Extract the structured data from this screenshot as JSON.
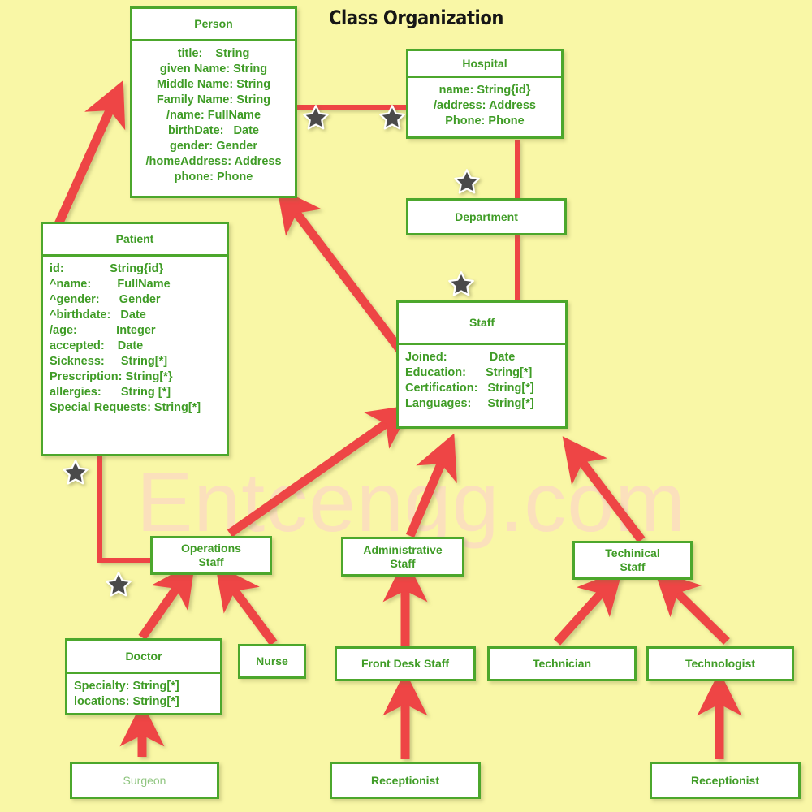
{
  "title": "Class Organization",
  "watermark": "Entcengg.com",
  "colors": {
    "background": "#f9f7a6",
    "class_border": "#4ca72c",
    "class_text": "#3f9c26",
    "connector": "#ee4444",
    "title_text": "#161616",
    "watermark": "#fbe0bc",
    "star": "#4a4a4a"
  },
  "classes": [
    {
      "id": "person",
      "name": "Person",
      "attributes": [
        "title:    String",
        "given Name: String",
        "Middle Name: String",
        "Family Name: String",
        "/name: FullName",
        "birthDate:   Date",
        "gender: Gender",
        "/homeAddress: Address",
        "phone: Phone"
      ]
    },
    {
      "id": "hospital",
      "name": "Hospital",
      "attributes": [
        "name: String{id}",
        "/address: Address",
        "Phone: Phone"
      ]
    },
    {
      "id": "patient",
      "name": "Patient",
      "attributes": [
        "id:              String{id}",
        "^name:        FullName",
        "^gender:      Gender",
        "^birthdate:   Date",
        "/age:            Integer",
        "accepted:    Date",
        "Sickness:     String[*]",
        "Prescription: String[*}",
        "allergies:      String [*]",
        "Special Requests: String[*]"
      ]
    },
    {
      "id": "department",
      "name": "Department",
      "attributes": []
    },
    {
      "id": "staff",
      "name": "Staff",
      "attributes": [
        "Joined:             Date",
        "Education:      String[*]",
        "Certification:   String[*]",
        "Languages:     String[*]"
      ]
    },
    {
      "id": "operations-staff",
      "name": "Operations\nStaff",
      "attributes": []
    },
    {
      "id": "administrative-staff",
      "name": "Administrative\nStaff",
      "attributes": []
    },
    {
      "id": "technical-staff",
      "name": "Techinical\nStaff",
      "attributes": []
    },
    {
      "id": "doctor",
      "name": "Doctor",
      "attributes": [
        "Specialty: String[*]",
        "locations: String[*]"
      ]
    },
    {
      "id": "nurse",
      "name": "Nurse",
      "attributes": []
    },
    {
      "id": "front-desk-staff",
      "name": "Front Desk Staff",
      "attributes": []
    },
    {
      "id": "technician",
      "name": "Technician",
      "attributes": []
    },
    {
      "id": "technologist",
      "name": "Technologist",
      "attributes": []
    },
    {
      "id": "surgeon",
      "name": "Surgeon",
      "attributes": []
    },
    {
      "id": "receptionist-admin",
      "name": "Receptionist",
      "attributes": []
    },
    {
      "id": "receptionist-tech",
      "name": "Receptionist",
      "attributes": []
    }
  ],
  "relations": [
    {
      "from": "patient",
      "to": "person",
      "kind": "generalization"
    },
    {
      "from": "staff",
      "to": "person",
      "kind": "generalization"
    },
    {
      "from": "person",
      "to": "hospital",
      "kind": "association"
    },
    {
      "from": "hospital",
      "to": "department",
      "kind": "association"
    },
    {
      "from": "department",
      "to": "staff",
      "kind": "association"
    },
    {
      "from": "patient",
      "to": "operations-staff",
      "kind": "association"
    },
    {
      "from": "operations-staff",
      "to": "staff",
      "kind": "generalization"
    },
    {
      "from": "administrative-staff",
      "to": "staff",
      "kind": "generalization"
    },
    {
      "from": "technical-staff",
      "to": "staff",
      "kind": "generalization"
    },
    {
      "from": "doctor",
      "to": "operations-staff",
      "kind": "generalization"
    },
    {
      "from": "nurse",
      "to": "operations-staff",
      "kind": "generalization"
    },
    {
      "from": "front-desk-staff",
      "to": "administrative-staff",
      "kind": "generalization"
    },
    {
      "from": "technician",
      "to": "technical-staff",
      "kind": "generalization"
    },
    {
      "from": "technologist",
      "to": "technical-staff",
      "kind": "generalization"
    },
    {
      "from": "surgeon",
      "to": "doctor",
      "kind": "generalization"
    },
    {
      "from": "receptionist-admin",
      "to": "front-desk-staff",
      "kind": "generalization"
    },
    {
      "from": "receptionist-tech",
      "to": "technologist",
      "kind": "generalization"
    }
  ],
  "markers": {
    "count": 7,
    "label": "star"
  }
}
